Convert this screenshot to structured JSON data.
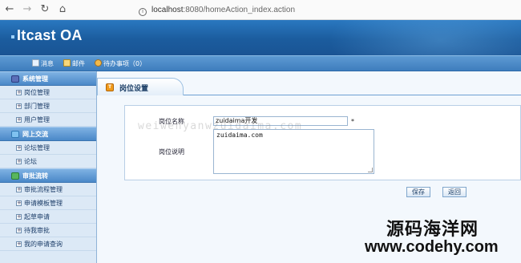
{
  "browser": {
    "url_host": "localhost",
    "url_rest": ":8080/homeAction_index.action"
  },
  "header": {
    "logo": "Itcast OA"
  },
  "toolbar": {
    "message_label": "消息",
    "mail_label": "邮件",
    "todo_label": "待办事项（0）"
  },
  "sidebar": {
    "groups": [
      {
        "label": "系统管理",
        "items": [
          "岗位管理",
          "部门管理",
          "用户管理"
        ]
      },
      {
        "label": "网上交流",
        "items": [
          "论坛管理",
          "论坛"
        ]
      },
      {
        "label": "审批流转",
        "items": [
          "审批流程管理",
          "申请模板管理",
          "起草申请",
          "待我审批",
          "我的申请查询"
        ]
      }
    ]
  },
  "main": {
    "tab_title": "岗位设置",
    "form": {
      "name_label": "岗位名称",
      "name_value": "zuidaima开发",
      "required_mark": "*",
      "desc_label": "岗位说明",
      "desc_value": "zuidaima.com"
    },
    "save_label": "保存",
    "back_label": "返回"
  },
  "overlay": {
    "watermark": "weiwenyanwzuidaima.com",
    "brand_cn": "源码海洋网",
    "brand_url": "www.codehy.com"
  },
  "colors": {
    "banner": "#1b5c9e",
    "toolbar": "#3e7dbd",
    "sidebar_bg": "#dce9f6",
    "main_bg": "#f3f8fd",
    "tab_icon": "#f09a1a"
  }
}
